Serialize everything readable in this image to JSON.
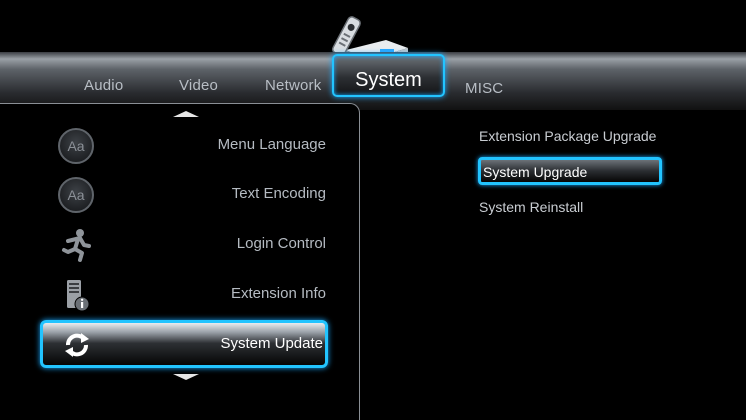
{
  "tabs": {
    "audio": "Audio",
    "video": "Video",
    "network": "Network",
    "system": "System",
    "misc": "MISC"
  },
  "menu": {
    "items": [
      {
        "label": "Menu Language",
        "icon": "text-aa-icon"
      },
      {
        "label": "Text Encoding",
        "icon": "text-aa-icon"
      },
      {
        "label": "Login Control",
        "icon": "running-man-icon"
      },
      {
        "label": "Extension Info",
        "icon": "info-device-icon"
      },
      {
        "label": "System Update",
        "icon": "refresh-icon",
        "selected": true
      }
    ],
    "aa_glyph": "Aa"
  },
  "submenu": {
    "items": [
      {
        "label": "Extension Package Upgrade"
      },
      {
        "label": "System Upgrade",
        "selected": true
      },
      {
        "label": "System Reinstall"
      }
    ]
  },
  "colors": {
    "highlight": "#22c4ff",
    "background": "#000000",
    "text": "#c9cdd2"
  }
}
